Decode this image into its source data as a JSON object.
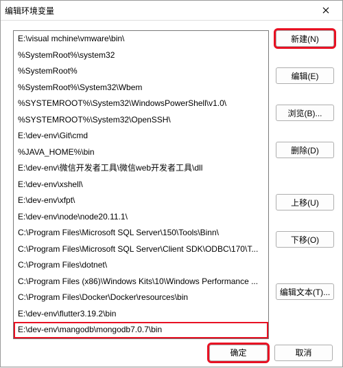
{
  "title": "编辑环境变量",
  "paths": [
    "E:\\visual mchine\\vmware\\bin\\",
    "%SystemRoot%\\system32",
    "%SystemRoot%",
    "%SystemRoot%\\System32\\Wbem",
    "%SYSTEMROOT%\\System32\\WindowsPowerShell\\v1.0\\",
    "%SYSTEMROOT%\\System32\\OpenSSH\\",
    "E:\\dev-env\\Git\\cmd",
    "%JAVA_HOME%\\bin",
    "E:\\dev-env\\微信开发者工具\\微信web开发者工具\\dll",
    "E:\\dev-env\\xshell\\",
    "E:\\dev-env\\xfpt\\",
    "E:\\dev-env\\node\\node20.11.1\\",
    "C:\\Program Files\\Microsoft SQL Server\\150\\Tools\\Binn\\",
    "C:\\Program Files\\Microsoft SQL Server\\Client SDK\\ODBC\\170\\T...",
    "C:\\Program Files\\dotnet\\",
    "C:\\Program Files (x86)\\Windows Kits\\10\\Windows Performance ...",
    "C:\\Program Files\\Docker\\Docker\\resources\\bin",
    "E:\\dev-env\\flutter3.19.2\\bin",
    "E:\\dev-env\\mangodb\\mongodb7.0.7\\bin"
  ],
  "highlighted_path_index": 18,
  "buttons": {
    "new": "新建(N)",
    "edit": "编辑(E)",
    "browse": "浏览(B)...",
    "delete": "删除(D)",
    "moveup": "上移(U)",
    "movedown": "下移(O)",
    "edittext": "编辑文本(T)...",
    "ok": "确定",
    "cancel": "取消"
  }
}
